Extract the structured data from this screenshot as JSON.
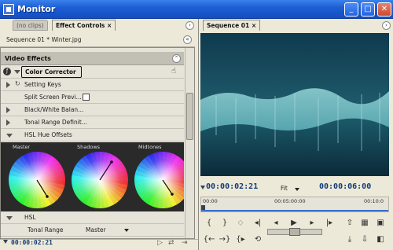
{
  "window": {
    "title": "Monitor"
  },
  "left_panel": {
    "tabs": [
      {
        "label": "(no clips)"
      },
      {
        "label": "Effect Controls ×"
      }
    ],
    "clip_path": "Sequence 01 * Winter.jpg",
    "section_title": "Video Effects",
    "effect_name": "Color Corrector",
    "rows": {
      "setting_keys": "Setting Keys",
      "split_screen": "Split Screen Previ...",
      "black_white": "Black/White Balan...",
      "tonal_range_def": "Tonal Range Definit...",
      "hsl_hue_offsets": "HSL Hue Offsets",
      "hsl": "HSL",
      "tonal_range": "Tonal Range"
    },
    "tonal_range_value": "Master",
    "wheel_labels": {
      "master": "Master",
      "shadows": "Shadows",
      "midtones": "Midtones"
    },
    "bottom_timecode": "00:00:02:21"
  },
  "right_panel": {
    "tab": "Sequence 01 ×",
    "current_timecode": "00:00:02:21",
    "zoom": "Fit",
    "duration_timecode": "00:00:06:00",
    "ruler": [
      "00:00",
      "00:05:00:00",
      "00:10:0"
    ]
  },
  "colors": {
    "accent": "#123a7a",
    "title_bar": "#1d5fd4",
    "image_teal": "#2c8a99"
  }
}
